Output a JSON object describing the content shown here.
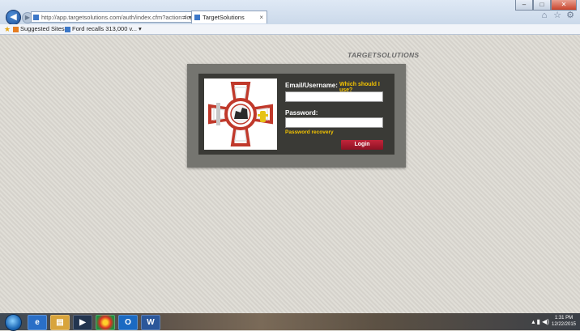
{
  "browser": {
    "address_url": "http://app.targetsolutions.com/auth/index.cfm?action=login.showlo",
    "tab_title": "TargetSolutions",
    "favorites": [
      "Suggested Sites ▾",
      "Ford recalls 313,000 v... ▾"
    ]
  },
  "page": {
    "brand": "TARGETSOLUTIONS",
    "login": {
      "email_label": "Email/Username:",
      "help_link": "Which should I use?",
      "email_value": "",
      "password_label": "Password:",
      "password_value": "",
      "recovery_link": "Password recovery",
      "login_button": "Login"
    }
  },
  "taskbar": {
    "items": [
      "ie-icon",
      "explorer-icon",
      "media-icon",
      "chrome-icon",
      "outlook-icon",
      "word-icon"
    ],
    "clock_time": "1:31 PM",
    "clock_date": "12/22/2015"
  },
  "colors": {
    "card": "#757570",
    "card_inner": "#3a3a36",
    "link_yellow": "#f4c400",
    "login_red": "#b01e30"
  }
}
